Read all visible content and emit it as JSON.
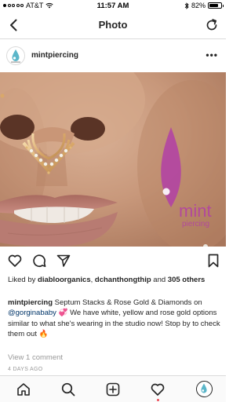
{
  "status_bar": {
    "carrier": "AT&T",
    "time": "11:57 AM",
    "battery": "82%",
    "battery_level": 0.82
  },
  "nav": {
    "title": "Photo",
    "back_icon": "chevron-left-icon",
    "refresh_icon": "refresh-icon"
  },
  "post": {
    "username": "mintpiercing",
    "more_icon": "more-dots-icon",
    "watermark": {
      "text": "mint piercing",
      "color": "#b23fa6"
    }
  },
  "actions": {
    "like_icon": "heart-icon",
    "comment_icon": "comment-icon",
    "share_icon": "send-icon",
    "save_icon": "bookmark-icon"
  },
  "likes": {
    "prefix": "Liked by",
    "user1": "diabloorganics",
    "separator": ",",
    "user2": "dchanthongthip",
    "and_text": "and",
    "others": "305 others"
  },
  "caption": {
    "username": "mintpiercing",
    "text_part1": "Septum Stacks & Rose Gold & Diamonds on",
    "mention": "@gorginababy",
    "emoji1": "💞",
    "text_part2": "We have white, yellow and rose gold options similar to what she's wearing in the studio now! Stop by to check them out",
    "emoji2": "🔥"
  },
  "comments_link": "View 1 comment",
  "time_ago": "4 DAYS AGO",
  "tab_bar": {
    "home_icon": "home-icon",
    "search_icon": "search-icon",
    "add_icon": "add-post-icon",
    "activity_icon": "heart-icon",
    "profile_icon": "profile-avatar-icon"
  },
  "colors": {
    "text": "#262626",
    "muted": "#999999",
    "divider": "#dbdbdb",
    "mention": "#003569",
    "notification": "#ed4956",
    "brand_magenta": "#b23fa6"
  }
}
